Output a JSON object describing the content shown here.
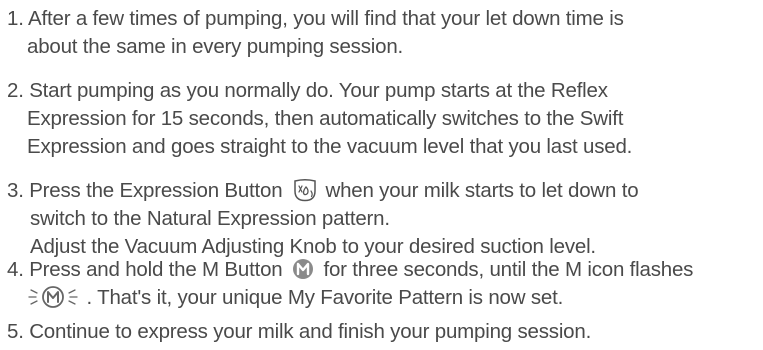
{
  "steps": [
    {
      "lines": [
        "1. After a few times of pumping, you will find that your let down time is",
        "about the same in every pumping session."
      ]
    },
    {
      "lines": [
        "2. Start pumping as you normally do. Your pump starts at the Reflex",
        "Expression for 15 seconds, then automatically switches to the Swift",
        "Expression and goes straight to the vacuum level that you last used."
      ]
    },
    {
      "line1_before": "3. Press the Expression Button",
      "line1_after": "when your milk starts to let down to",
      "line2": "switch to the Natural Expression pattern.",
      "line3": "Adjust the Vacuum Adjusting Knob to your desired suction level."
    },
    {
      "line1_before": "4. Press and hold the M Button",
      "line1_after": "for three seconds, until the M icon flashes",
      "line2_after": ". That's it, your unique My Favorite Pattern is now set."
    },
    {
      "lines": [
        "5. Continue to express your milk and finish your pumping session."
      ]
    }
  ],
  "icons": {
    "expression_button": "expression-button-icon",
    "m_button": "m-button-icon",
    "m_flashing": "m-flashing-icon"
  },
  "colors": {
    "text": "#4a4a4a",
    "m_button_fill": "#8a8a8a"
  }
}
